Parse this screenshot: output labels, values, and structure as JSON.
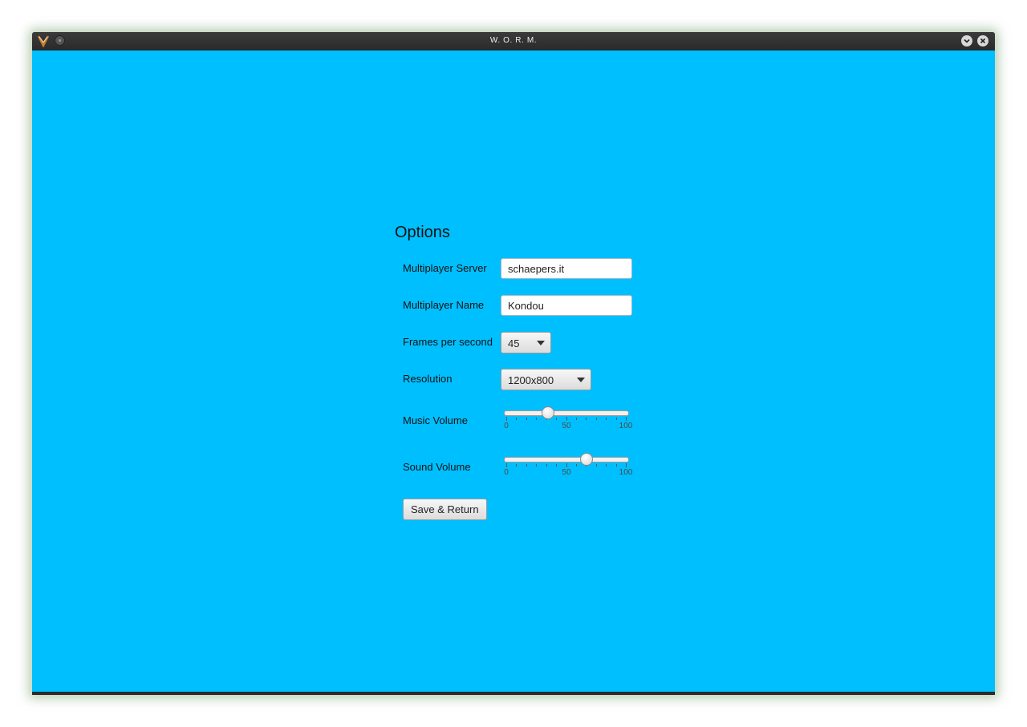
{
  "window": {
    "title": "W. O. R. M.",
    "icons": {
      "app_logo": "worm-app-logo-icon",
      "menu_dot": "window-menu-dot-icon",
      "minimize": "chevron-down-icon",
      "close": "close-icon"
    },
    "background_color": "#00bfff"
  },
  "options": {
    "title": "Options",
    "multiplayer_server": {
      "label": "Multiplayer Server",
      "value": "schaepers.it"
    },
    "multiplayer_name": {
      "label": "Multiplayer Name",
      "value": "Kondou"
    },
    "frames_per_second": {
      "label": "Frames per second",
      "selected": "45"
    },
    "resolution": {
      "label": "Resolution",
      "selected": "1200x800"
    },
    "music_volume": {
      "label": "Music Volume",
      "value": 35,
      "min": 0,
      "max": 100,
      "tick_labels": [
        "0",
        "50",
        "100"
      ]
    },
    "sound_volume": {
      "label": "Sound Volume",
      "value": 67,
      "min": 0,
      "max": 100,
      "tick_labels": [
        "0",
        "50",
        "100"
      ]
    },
    "save_button_label": "Save & Return"
  }
}
